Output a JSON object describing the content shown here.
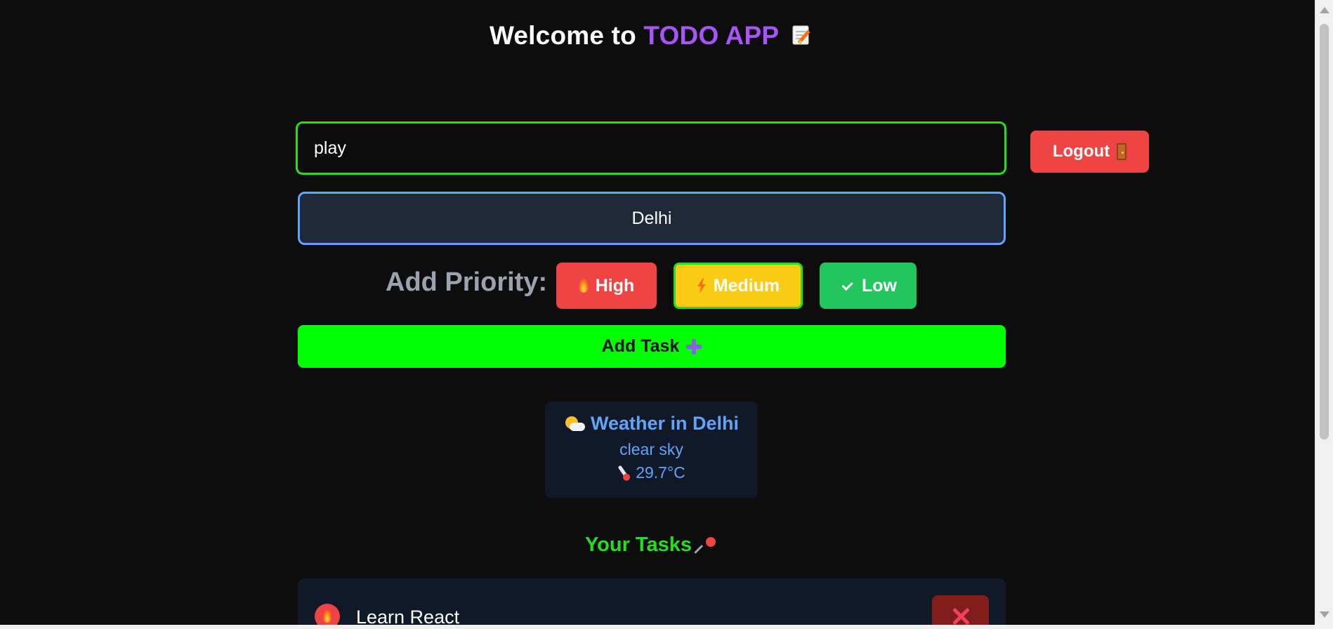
{
  "header": {
    "title_prefix": "Welcome to",
    "title_accent": "TODO APP",
    "title_icon": "memo-icon"
  },
  "task_input": {
    "value": "play",
    "placeholder": ""
  },
  "logout": {
    "label": "Logout",
    "icon": "door-icon"
  },
  "city_select": {
    "selected": "Delhi"
  },
  "priority": {
    "label": "Add Priority:",
    "options": [
      {
        "label": "High",
        "icon": "fire-icon",
        "color": "#ef4444",
        "selected": false
      },
      {
        "label": "Medium",
        "icon": "lightning-icon",
        "color": "#facc15",
        "selected": true
      },
      {
        "label": "Low",
        "icon": "check-icon",
        "color": "#22c55e",
        "selected": false
      }
    ]
  },
  "add_task": {
    "label": "Add Task",
    "icon": "plus-icon"
  },
  "weather": {
    "title": "Weather in Delhi",
    "icon": "sun-behind-cloud-icon",
    "description": "clear sky",
    "temperature": "29.7°C",
    "temp_icon": "thermometer-icon"
  },
  "tasks": {
    "heading": "Your Tasks",
    "heading_icon": "pushpin-icon",
    "items": [
      {
        "text": "Learn React",
        "priority": "High",
        "priority_icon": "fire-icon",
        "delete_icon": "x-icon"
      }
    ]
  },
  "colors": {
    "background": "#0d0d0d",
    "accent_purple": "#a855f7",
    "accent_green": "#22e01c",
    "add_task_green": "#00ff00",
    "weather_blue": "#60a5fa",
    "logout_red": "#ef4444"
  }
}
